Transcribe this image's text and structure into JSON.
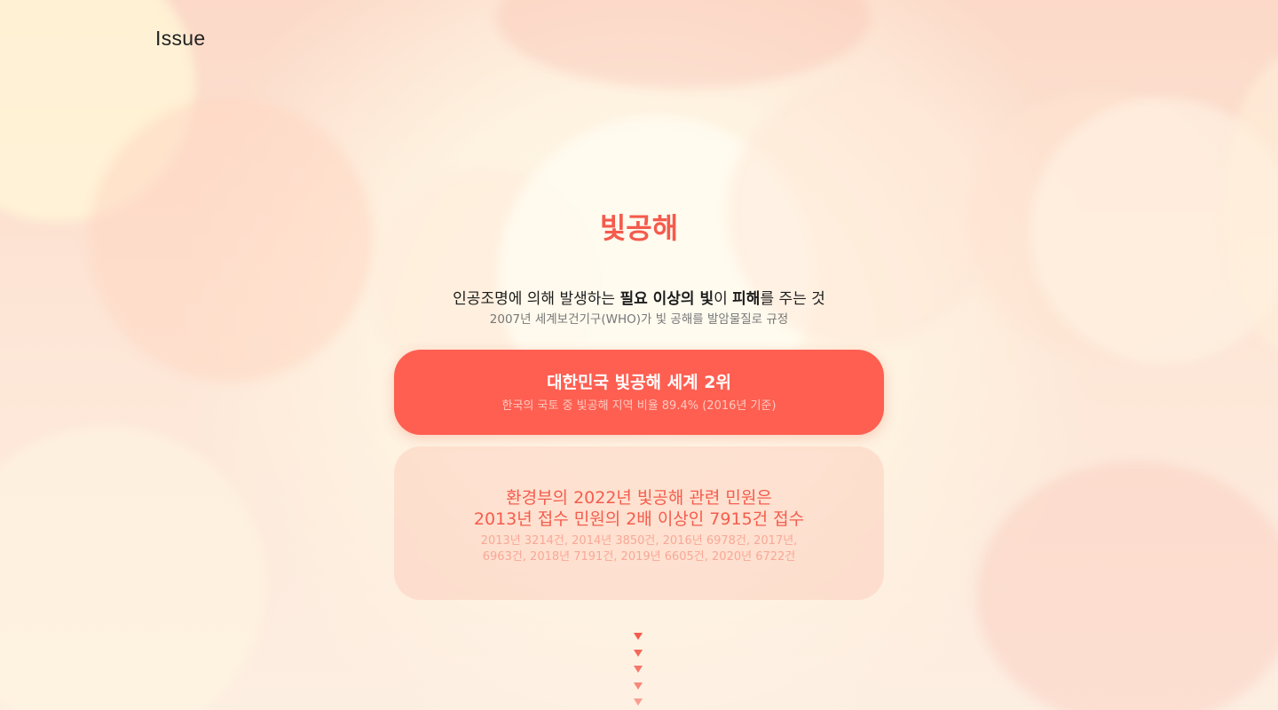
{
  "header": {
    "title": "Issue"
  },
  "main": {
    "title": "빛공해",
    "definition": {
      "part1": "인공조명에 의해 발생하는 ",
      "bold1": "필요 이상의 빛",
      "part2": "이 ",
      "bold2": "피해",
      "part3": "를 주는 것"
    },
    "definition_sub": "2007년 세계보건기구(WHO)가 빛 공해를 발암물질로 규정",
    "card_primary": {
      "heading": "대한민국 빛공해 세계 2위",
      "sub": "한국의 국토 중 빛공해 지역 비율 89.4% (2016년 기준)"
    },
    "card_secondary": {
      "line1": "환경부의 2022년 빛공해 관련 민원은",
      "line2": "2013년 접수 민원의 2배 이상인 7915건 접수",
      "detail1": "2013년 3214건, 2014년 3850건, 2016년 6978건, 2017년,",
      "detail2": "6963건, 2018년 7191건, 2019년 6605건, 2020년 6722건"
    },
    "scroll_indicator": {
      "icon": "down-triangle-icon",
      "count": 5
    }
  },
  "colors": {
    "accent": "#f45b4d",
    "card_primary_bg": "#fe5f51",
    "card_secondary_bg": "#fdc6b6"
  }
}
